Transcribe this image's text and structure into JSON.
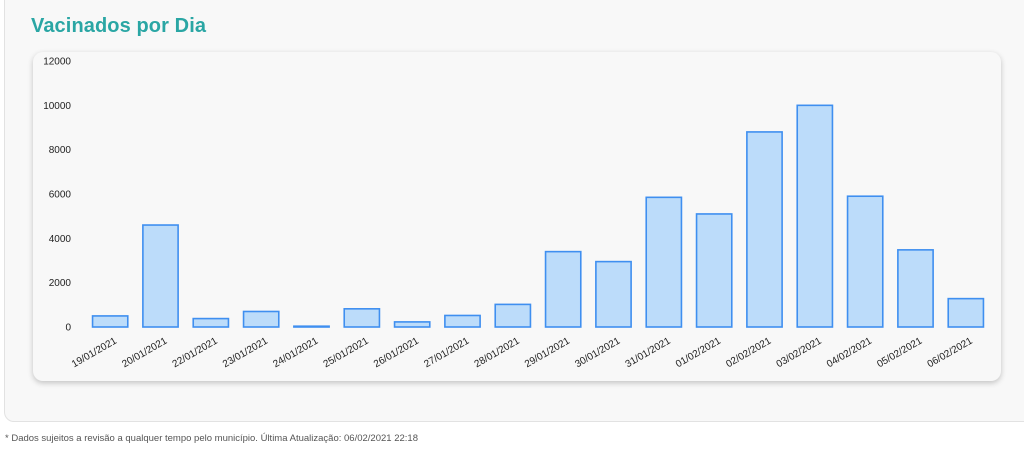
{
  "title": "Vacinados por Dia",
  "footnote": "* Dados sujeitos a revisão a qualquer tempo pelo município. Última Atualização: 06/02/2021 22:18",
  "colors": {
    "title": "#2aa6a4",
    "bar_fill": "#bcdcfa",
    "bar_stroke": "#3f8ff0",
    "axis_text": "#222222"
  },
  "chart_data": {
    "type": "bar",
    "title": "",
    "xlabel": "",
    "ylabel": "",
    "ylim": [
      0,
      12000
    ],
    "yticks": [
      0,
      2000,
      4000,
      6000,
      8000,
      10000,
      12000
    ],
    "ytick_labels": [
      "0",
      "2000",
      "4000",
      "6000",
      "8000",
      "10000",
      "12000"
    ],
    "grid": false,
    "categories": [
      "19/01/2021",
      "20/01/2021",
      "22/01/2021",
      "23/01/2021",
      "24/01/2021",
      "25/01/2021",
      "26/01/2021",
      "27/01/2021",
      "28/01/2021",
      "29/01/2021",
      "30/01/2021",
      "31/01/2021",
      "01/02/2021",
      "02/02/2021",
      "03/02/2021",
      "04/02/2021",
      "05/02/2021",
      "06/02/2021"
    ],
    "values": [
      500,
      4600,
      380,
      700,
      30,
      820,
      230,
      520,
      1020,
      3400,
      2950,
      5850,
      5100,
      8800,
      10000,
      5900,
      3480,
      1280
    ]
  }
}
